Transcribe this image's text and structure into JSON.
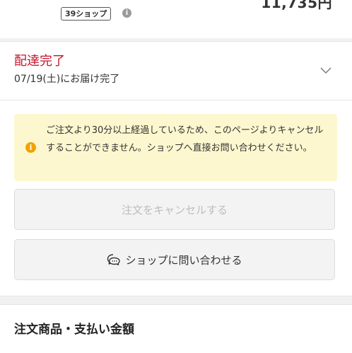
{
  "order_summary": {
    "price": "11,735円",
    "shop_badge": "39ショップ",
    "info_icon": "info-icon"
  },
  "delivery_status": {
    "title": "配達完了",
    "subtitle": "07/19(土)にお届け完了",
    "expand_icon": "chevron-down-icon",
    "title_color": "#c4152b"
  },
  "notice": {
    "text": "ご注文より30分以上経過しているため、このページよりキャンセルすることができません。ショップへ直接お問い合わせください。",
    "icon": "info-icon",
    "background": "#fdf7cf",
    "icon_color": "#f0a300"
  },
  "actions": {
    "cancel_label": "注文をキャンセルする",
    "cancel_disabled": true,
    "contact_label": "ショップに問い合わせる",
    "contact_icon": "chat-icon"
  },
  "section": {
    "title": "注文商品・支払い金額"
  }
}
